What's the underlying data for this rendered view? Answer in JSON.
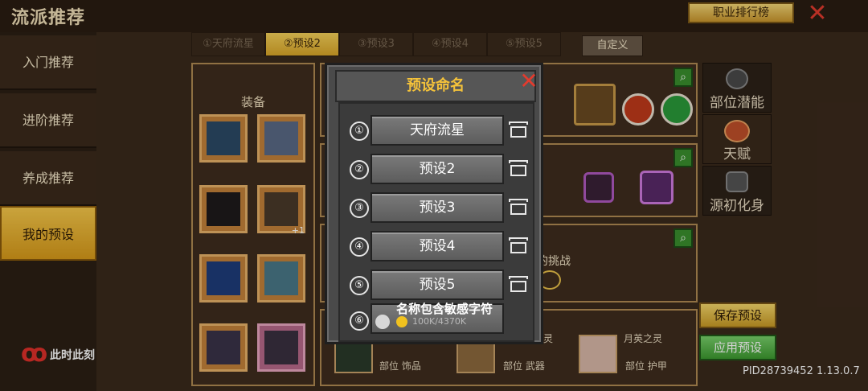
{
  "header": {
    "title": "流派推荐",
    "rank_button": "职业排行榜",
    "close_icon": "close-icon"
  },
  "sidebar": {
    "items": [
      {
        "label": "入门推荐",
        "active": false
      },
      {
        "label": "进阶推荐",
        "active": false
      },
      {
        "label": "养成推荐",
        "active": false
      },
      {
        "label": "我的预设",
        "active": true
      }
    ],
    "brand": "此时此刻"
  },
  "tabs": [
    {
      "label": "①天府流星",
      "active": false
    },
    {
      "label": "②预设2",
      "active": true
    },
    {
      "label": "③预设3",
      "active": false
    },
    {
      "label": "④预设4",
      "active": false
    },
    {
      "label": "⑤预设5",
      "active": false
    }
  ],
  "custom_tab": "自定义",
  "equipment": {
    "title": "装备"
  },
  "panel_text": {
    "challenge_label": "的挑战"
  },
  "right_column": {
    "buttons": [
      "部位潜能",
      "天赋",
      "源初化身"
    ]
  },
  "bottom_row": {
    "items": [
      {
        "name": "",
        "slot": "部位 饰品"
      },
      {
        "name": "灵",
        "slot": "部位 武器"
      },
      {
        "name": "月英之灵",
        "slot": "部位 护甲"
      }
    ]
  },
  "actions": {
    "save": "保存预设",
    "apply": "应用预设"
  },
  "pid": "PID28739452 1.13.0.7",
  "modal": {
    "title": "预设命名",
    "rows": [
      {
        "num": "①",
        "name": "天府流星"
      },
      {
        "num": "②",
        "name": "预设2"
      },
      {
        "num": "③",
        "name": "预设3"
      },
      {
        "num": "④",
        "name": "预设4"
      },
      {
        "num": "⑤",
        "name": "预设5"
      }
    ],
    "row6_num": "⑥",
    "sensitive_toast": "名称包含敏感字符",
    "row6_progress": "100K/4370K"
  },
  "colors": {
    "accent_gold": "#f4c23a",
    "close_red": "#e23b2e",
    "apply_green": "#3d9a30"
  }
}
